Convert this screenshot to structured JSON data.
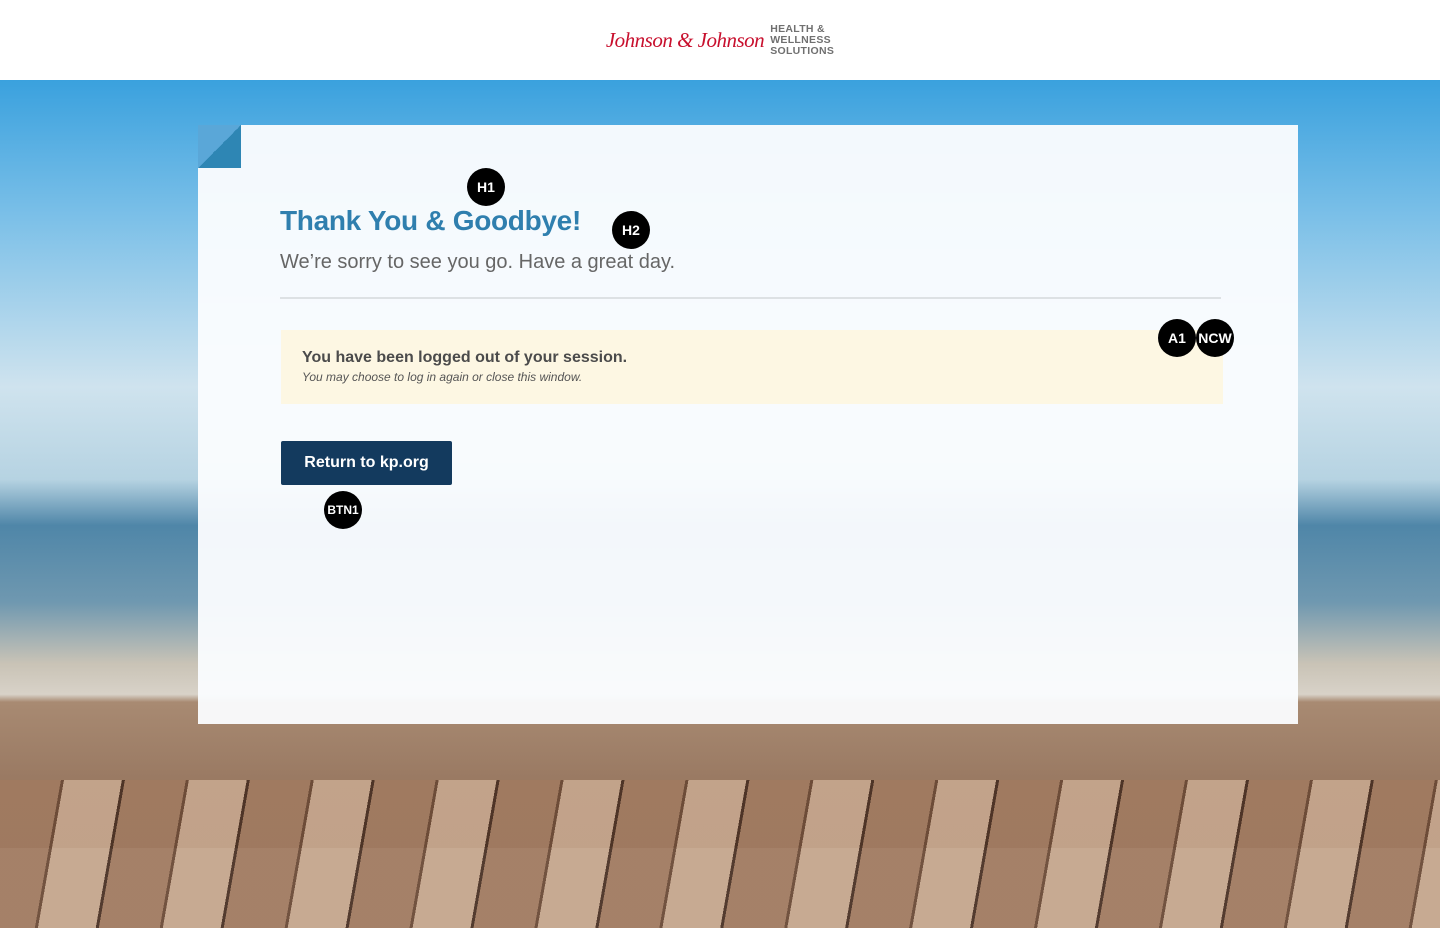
{
  "header": {
    "logo_script": "Johnson & Johnson",
    "logo_lines": [
      "HEALTH &",
      "WELLNESS",
      "SOLUTIONS"
    ]
  },
  "main": {
    "title": "Thank You & Goodbye!",
    "subtitle": "We’re sorry to see you go.  Have a great day.",
    "alert": {
      "title": "You have been logged out of your session.",
      "message": "You may choose to log in again or close this window."
    },
    "button_label": "Return to kp.org"
  },
  "markers": {
    "h1": "H1",
    "h2": "H2",
    "a1": "A1",
    "ncw": "NCW",
    "btn1": "BTN1"
  },
  "colors": {
    "title": "#2f7fae",
    "button": "#133a5e",
    "alert_bg": "#fdf7e3",
    "logo_red": "#c8102e"
  }
}
